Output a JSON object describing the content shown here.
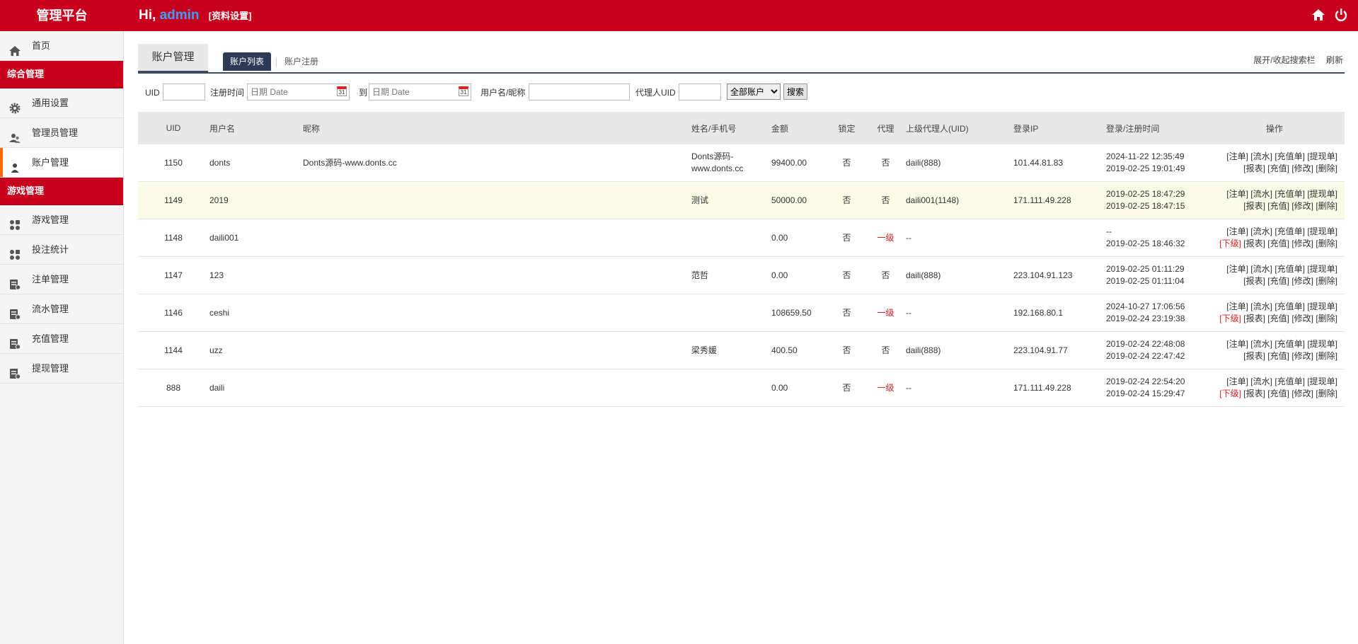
{
  "header": {
    "brand": "管理平台",
    "hi": "Hi,",
    "user": "admin",
    "profile_link": "[资料设置]"
  },
  "sidebar": {
    "items_top": [
      {
        "label": "首页",
        "icon": "home-icon"
      }
    ],
    "group1": "综合管理",
    "group1_items": [
      {
        "label": "通用设置",
        "icon": "gear-icon"
      },
      {
        "label": "管理员管理",
        "icon": "users-icon"
      },
      {
        "label": "账户管理",
        "icon": "user-icon"
      }
    ],
    "group2": "游戏管理",
    "group2_items": [
      {
        "label": "游戏管理",
        "icon": "apps-icon"
      },
      {
        "label": "投注统计",
        "icon": "apps-icon"
      },
      {
        "label": "注单管理",
        "icon": "ledger-icon"
      },
      {
        "label": "流水管理",
        "icon": "ledger-icon"
      },
      {
        "label": "充值管理",
        "icon": "ledger-icon"
      },
      {
        "label": "提现管理",
        "icon": "ledger-icon"
      }
    ]
  },
  "main": {
    "title": "账户管理",
    "tabs": [
      "账户列表",
      "账户注册"
    ],
    "toggle_search": "展开/收起搜索栏",
    "refresh": "刷新"
  },
  "search": {
    "uid_label": "UID",
    "reg_time_label": "注册时间",
    "date_placeholder": "日期 Date",
    "to_label": "到",
    "username_label": "用户名/昵称",
    "agent_uid_label": "代理人UID",
    "account_type": "全部账户",
    "search_btn": "搜索"
  },
  "table": {
    "headers": [
      "UID",
      "用户名",
      "昵称",
      "姓名/手机号",
      "金额",
      "锁定",
      "代理",
      "上级代理人(UID)",
      "登录IP",
      "登录/注册时间",
      "操作"
    ],
    "rows": [
      {
        "uid": "1150",
        "username": "donts",
        "nickname": "Donts源码-www.donts.cc",
        "name": "Donts源码-",
        "name2": "www.donts.cc",
        "amount": "99400.00",
        "locked": "否",
        "agent": "否",
        "parent": "daili(888)",
        "ip": "101.44.81.83",
        "login": "2024-11-22 12:35:49",
        "reg": "2019-02-25 19:01:49",
        "sub": ""
      },
      {
        "uid": "1149",
        "username": "2019",
        "nickname": "",
        "name": "测试",
        "name2": "",
        "amount": "50000.00",
        "locked": "否",
        "agent": "否",
        "parent": "daili001(1148)",
        "ip": "171.111.49.228",
        "login": "2019-02-25 18:47:29",
        "reg": "2019-02-25 18:47:15",
        "sub": ""
      },
      {
        "uid": "1148",
        "username": "daili001",
        "nickname": "",
        "name": "",
        "name2": "",
        "amount": "0.00",
        "locked": "否",
        "agent": "一级",
        "parent": "--",
        "ip": "",
        "login": "--",
        "reg": "2019-02-25 18:46:32",
        "sub": "[下级]"
      },
      {
        "uid": "1147",
        "username": "123",
        "nickname": "",
        "name": "范哲",
        "name2": "",
        "amount": "0.00",
        "locked": "否",
        "agent": "否",
        "parent": "daili(888)",
        "ip": "223.104.91.123",
        "login": "2019-02-25 01:11:29",
        "reg": "2019-02-25 01:11:04",
        "sub": ""
      },
      {
        "uid": "1146",
        "username": "ceshi",
        "nickname": "",
        "name": "",
        "name2": "",
        "amount": "108659.50",
        "locked": "否",
        "agent": "一级",
        "parent": "--",
        "ip": "192.168.80.1",
        "login": "2024-10-27 17:06:56",
        "reg": "2019-02-24 23:19:38",
        "sub": "[下级]"
      },
      {
        "uid": "1144",
        "username": "uzz",
        "nickname": "",
        "name": "梁秀媛",
        "name2": "",
        "amount": "400.50",
        "locked": "否",
        "agent": "否",
        "parent": "daili(888)",
        "ip": "223.104.91.77",
        "login": "2019-02-24 22:48:08",
        "reg": "2019-02-24 22:47:42",
        "sub": ""
      },
      {
        "uid": "888",
        "username": "daili",
        "nickname": "",
        "name": "",
        "name2": "",
        "amount": "0.00",
        "locked": "否",
        "agent": "一级",
        "parent": "--",
        "ip": "171.111.49.228",
        "login": "2019-02-24 22:54:20",
        "reg": "2019-02-24 15:29:47",
        "sub": "[下级]"
      }
    ],
    "ops_line1": [
      "[注单]",
      "[流水]",
      "[充值单]",
      "[提现单]"
    ],
    "ops_line2": [
      "[报表]",
      "[充值]",
      "[修改]",
      "[删除]"
    ]
  }
}
